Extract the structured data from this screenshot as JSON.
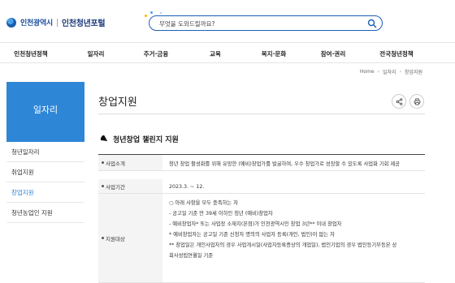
{
  "header": {
    "logo_city": "인천광역시",
    "logo_portal": "인천청년포털",
    "search_placeholder": "무엇을 도와드릴까요?"
  },
  "nav": {
    "items": [
      "인천청년정책",
      "일자리",
      "주거·금융",
      "교육",
      "복지·문화",
      "참여·권리",
      "전국청년정책"
    ]
  },
  "breadcrumb": {
    "home": "Home",
    "level1": "일자리",
    "level2": "창업지원"
  },
  "sidebar": {
    "title": "일자리",
    "items": [
      {
        "label": "청년일자리",
        "active": false
      },
      {
        "label": "취업지원",
        "active": false
      },
      {
        "label": "창업지원",
        "active": true
      },
      {
        "label": "청년농업인 지원",
        "active": false
      }
    ]
  },
  "main": {
    "page_title": "창업지원",
    "section_title": "청년창업 챌린지 지원",
    "rows": [
      {
        "label": "사업소개",
        "lines": [
          "청년 창업 활성화를 위해 유망한 (예비)창업가를 발굴하여, 우수 창업가로 성장할 수 있도록 사업화 기회 제공"
        ]
      },
      {
        "label": "사업기간",
        "lines": [
          "2023.3. ~ 12."
        ]
      },
      {
        "label": "지원대상",
        "lines": [
          "○ 아래 사항을 모두 충족하는 자",
          " - 공고일 기준 만 39세 이하인 청년 (예비)창업자",
          " - 예비창업자* 또는 사업장 소재지(본점)가 인천광역시인 창업 3년** 이내 창업자",
          "  * 예비창업자는 공고일 기준 신청자 명의의 사업자 등록(개인, 법인)이 없는 자",
          "  ** 창업일은 개인사업자의 경우 사업개시일(사업자등록증상의 개업일), 법인기업의 경우 법인등기부등본 상",
          "  회사성립연월일 기준"
        ]
      }
    ]
  },
  "colors": {
    "brand_blue": "#2e86d6",
    "search_border": "#1d5fb5"
  }
}
